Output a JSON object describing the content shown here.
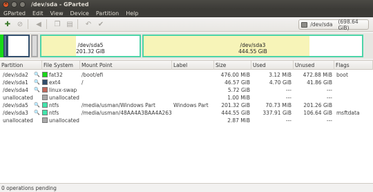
{
  "window": {
    "title": "/dev/sda - GParted"
  },
  "menu": [
    "GParted",
    "Edit",
    "View",
    "Device",
    "Partition",
    "Help"
  ],
  "device": {
    "name": "/dev/sda",
    "size": "(698.64 GiB)"
  },
  "diskmap": {
    "sda5": {
      "name": "/dev/sda5",
      "size": "201.32 GiB",
      "used_fraction": 0.35
    },
    "sda3": {
      "name": "/dev/sda3",
      "size": "444.55 GiB",
      "used_fraction": 0.76
    }
  },
  "columns": [
    "Partition",
    "File System",
    "Mount Point",
    "Label",
    "Size",
    "Used",
    "Unused",
    "Flags"
  ],
  "rows": [
    {
      "partition": "/dev/sda2",
      "fs": "fat32",
      "fs_color": "#18d918",
      "mount": "/boot/efi",
      "label": "",
      "size": "476.00 MiB",
      "used": "3.12 MiB",
      "unused": "472.88 MiB",
      "flags": "boot",
      "key": true
    },
    {
      "partition": "/dev/sda1",
      "fs": "ext4",
      "fs_color": "#314e6c",
      "mount": "/",
      "label": "",
      "size": "46.57 GiB",
      "used": "4.70 GiB",
      "unused": "41.86 GiB",
      "flags": "",
      "key": true
    },
    {
      "partition": "/dev/sda4",
      "fs": "linux-swap",
      "fs_color": "#c1665a",
      "mount": "",
      "label": "",
      "size": "5.72 GiB",
      "used": "---",
      "unused": "---",
      "flags": "",
      "key": true
    },
    {
      "partition": "unallocated",
      "fs": "unallocated",
      "fs_color": "#a9a9a9",
      "mount": "",
      "label": "",
      "size": "1.00 MiB",
      "used": "---",
      "unused": "---",
      "flags": "",
      "key": false
    },
    {
      "partition": "/dev/sda5",
      "fs": "ntfs",
      "fs_color": "#42e5ac",
      "mount": "/media/usman/Windows Part",
      "label": "Windows Part",
      "size": "201.32 GiB",
      "used": "70.73 MiB",
      "unused": "201.26 GiB",
      "flags": "",
      "key": true
    },
    {
      "partition": "/dev/sda3",
      "fs": "ntfs",
      "fs_color": "#42e5ac",
      "mount": "/media/usman/48AA4A3BAA4A2632",
      "label": "",
      "size": "444.55 GiB",
      "used": "337.91 GiB",
      "unused": "106.64 GiB",
      "flags": "msftdata",
      "key": true
    },
    {
      "partition": "unallocated",
      "fs": "unallocated",
      "fs_color": "#a9a9a9",
      "mount": "",
      "label": "",
      "size": "2.87 MiB",
      "used": "---",
      "unused": "---",
      "flags": "",
      "key": false
    }
  ],
  "status": "0 operations pending"
}
